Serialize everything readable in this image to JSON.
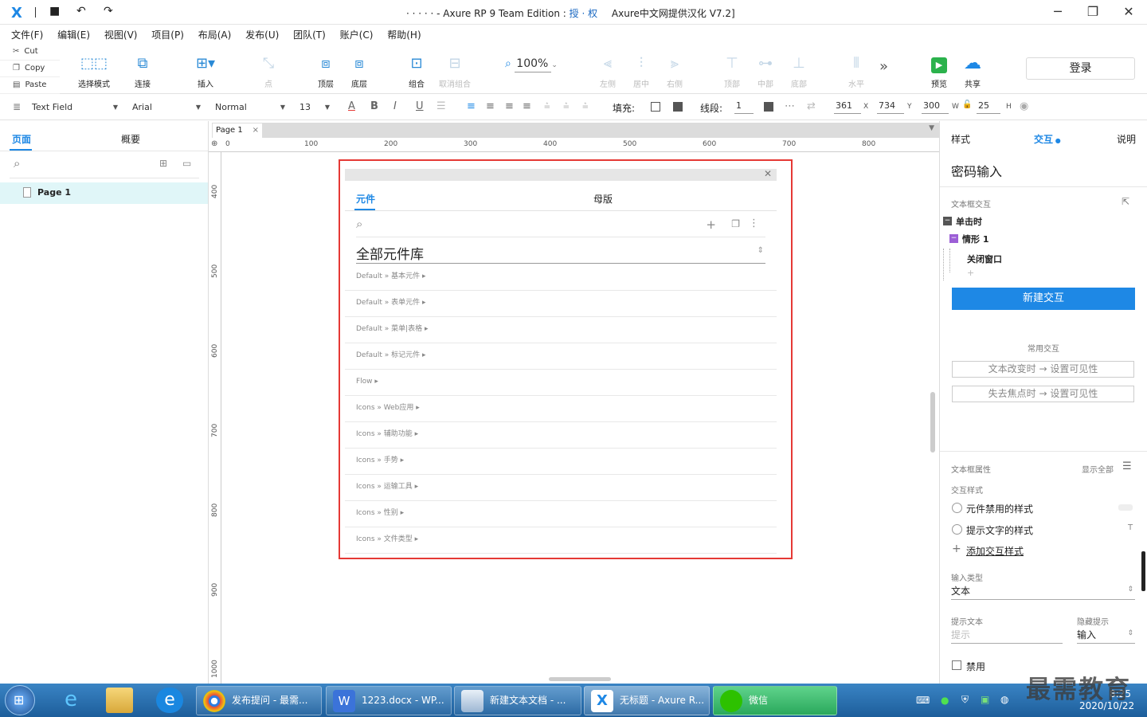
{
  "window": {
    "title_left": "· · · · ·  - Axure RP 9 Team Edition : ",
    "title_mid": "授 · 权",
    "title_right": "Axure中文网提供汉化 V7.2]"
  },
  "menu": [
    "文件(F)",
    "编辑(E)",
    "视图(V)",
    "项目(P)",
    "布局(A)",
    "发布(U)",
    "团队(T)",
    "账户(C)",
    "帮助(H)"
  ],
  "clipboard": {
    "cut": "Cut",
    "copy": "Copy",
    "paste": "Paste"
  },
  "toolbar": {
    "select_mode": "选择模式",
    "connect": "连接",
    "insert": "插入",
    "point": "点",
    "top": "顶层",
    "bottom": "底层",
    "group": "组合",
    "ungroup": "取消组合",
    "zoom": "100%",
    "align_left": "左侧",
    "align_center": "居中",
    "align_right": "右侧",
    "align_top": "顶部",
    "align_middle": "中部",
    "align_bottom": "底部",
    "distribute_h": "水平",
    "more": "»",
    "preview": "预览",
    "share": "共享",
    "login": "登录"
  },
  "format": {
    "widget_type": "Text Field",
    "font": "Arial",
    "style": "Normal",
    "size": "13",
    "fill_label": "填充:",
    "line_label": "线段:",
    "line_value": "1",
    "x": "361",
    "x_label": "X",
    "y": "734",
    "y_label": "Y",
    "w": "300",
    "w_label": "W",
    "h": "25",
    "h_label": "H"
  },
  "left_panel": {
    "tab_pages": "页面",
    "tab_outline": "概要",
    "page_name": "Page 1"
  },
  "canvas": {
    "tab": "Page 1",
    "ruler_h": [
      "0",
      "100",
      "200",
      "300",
      "400",
      "500",
      "600",
      "700",
      "800"
    ],
    "ruler_v": [
      "400",
      "500",
      "600",
      "700",
      "800",
      "900",
      "1000"
    ]
  },
  "library": {
    "tab_widgets": "元件",
    "tab_masters": "母版",
    "library_select": "全部元件库",
    "items": [
      "Default » 基本元件 ▸",
      "Default » 表单元件 ▸",
      "Default » 菜单|表格 ▸",
      "Default » 标记元件 ▸",
      "Flow ▸",
      "Icons » Web应用 ▸",
      "Icons » 辅助功能 ▸",
      "Icons » 手势 ▸",
      "Icons » 运输工具 ▸",
      "Icons » 性别 ▸",
      "Icons » 文件类型 ▸"
    ]
  },
  "right_panel": {
    "tab_style": "样式",
    "tab_interaction": "交互",
    "tab_notes": "说明",
    "widget_name": "密码输入",
    "section_interactions": "文本框交互",
    "event": "单击时",
    "case": "情形 1",
    "action": "关闭窗口",
    "add": "+",
    "new_interaction": "新建交互",
    "common_title": "常用交互",
    "common_1": "文本改变时 → 设置可见性",
    "common_2": "失去焦点时 → 设置可见性",
    "props_title": "文本框属性",
    "show_all": "显示全部",
    "interaction_styles": "交互样式",
    "disabled_style": "元件禁用的样式",
    "hint_style": "提示文字的样式",
    "add_style": "添加交互样式",
    "input_type_label": "输入类型",
    "input_type_value": "文本",
    "hint_text_label": "提示文本",
    "hint_text_placeholder": "提示",
    "hide_hint_label": "隐藏提示",
    "hide_hint_value": "输入",
    "disabled_label": "禁用"
  },
  "taskbar": {
    "tasks": [
      "发布提问 - 最需...",
      "1223.docx - WP...",
      "新建文本文档 - ...",
      "无标题 - Axure R...",
      "微信"
    ],
    "time": "8:25",
    "date": "2020/10/22",
    "watermark": "最需教育"
  }
}
